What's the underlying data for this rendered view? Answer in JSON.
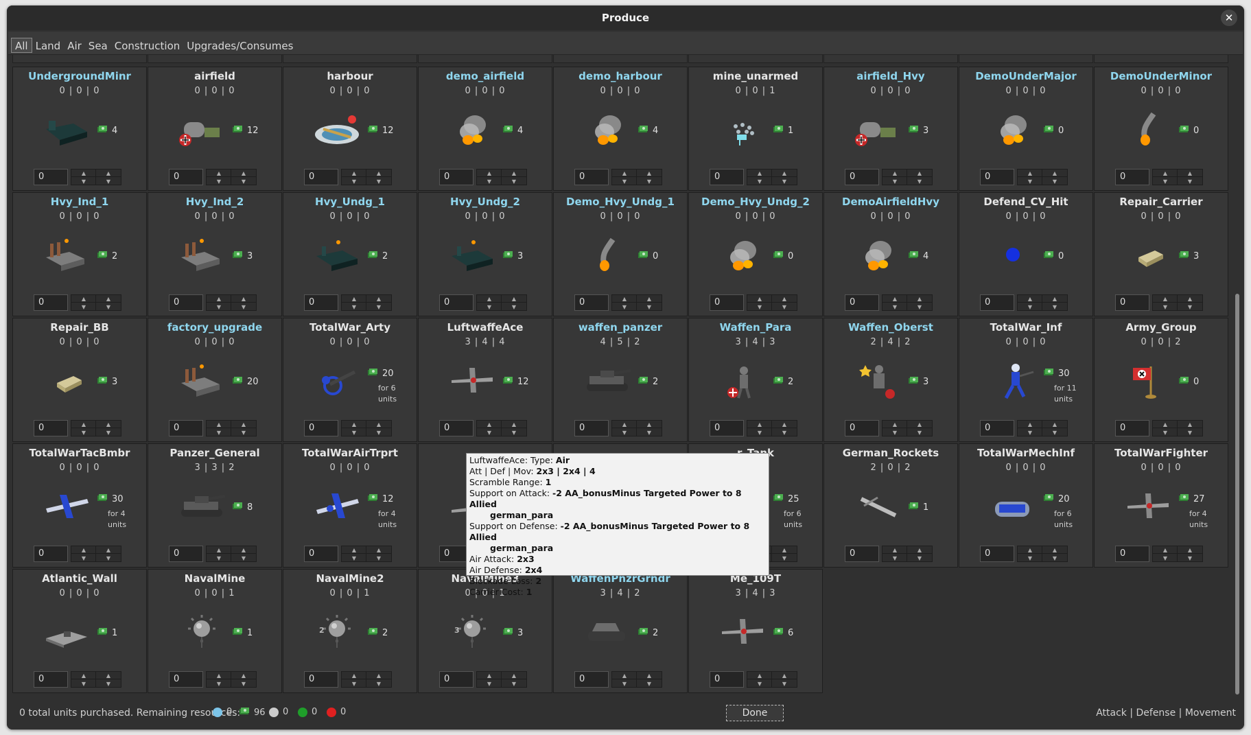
{
  "window": {
    "title": "Produce",
    "close": "✕"
  },
  "tabs": [
    "All",
    "Land",
    "Air",
    "Sea",
    "Construction",
    "Upgrades/Consumes"
  ],
  "units": [
    {
      "name": "UndergroundMinr",
      "blue": true,
      "stats": "0 | 0 | 0",
      "cost": "4",
      "icon": "underground-mine-icon",
      "qty": "0"
    },
    {
      "name": "airfield",
      "blue": false,
      "stats": "0 | 0 | 0",
      "cost": "12",
      "icon": "airfield-icon",
      "qty": "0"
    },
    {
      "name": "harbour",
      "blue": false,
      "stats": "0 | 0 | 0",
      "cost": "12",
      "icon": "harbour-icon",
      "qty": "0"
    },
    {
      "name": "demo_airfield",
      "blue": true,
      "stats": "0 | 0 | 0",
      "cost": "4",
      "icon": "fire-icon",
      "qty": "0"
    },
    {
      "name": "demo_harbour",
      "blue": true,
      "stats": "0 | 0 | 0",
      "cost": "4",
      "icon": "fire-icon",
      "qty": "0"
    },
    {
      "name": "mine_unarmed",
      "blue": false,
      "stats": "0 | 0 | 1",
      "cost": "1",
      "icon": "minefield-icon",
      "qty": "0"
    },
    {
      "name": "airfield_Hvy",
      "blue": true,
      "stats": "0 | 0 | 0",
      "cost": "3",
      "icon": "airfield-icon",
      "qty": "0"
    },
    {
      "name": "DemoUnderMajor",
      "blue": true,
      "stats": "0 | 0 | 0",
      "cost": "0",
      "icon": "fire-icon",
      "qty": "0"
    },
    {
      "name": "DemoUnderMinor",
      "blue": true,
      "stats": "0 | 0 | 0",
      "cost": "0",
      "icon": "flame-icon",
      "qty": "0"
    },
    {
      "name": "Hvy_Ind_1",
      "blue": true,
      "stats": "0 | 0 | 0",
      "cost": "2",
      "icon": "factory-icon",
      "qty": "0"
    },
    {
      "name": "Hvy_Ind_2",
      "blue": true,
      "stats": "0 | 0 | 0",
      "cost": "3",
      "icon": "factory-icon",
      "qty": "0"
    },
    {
      "name": "Hvy_Undg_1",
      "blue": true,
      "stats": "0 | 0 | 0",
      "cost": "2",
      "icon": "underground-factory-icon",
      "qty": "0"
    },
    {
      "name": "Hvy_Undg_2",
      "blue": true,
      "stats": "0 | 0 | 0",
      "cost": "3",
      "icon": "underground-factory-icon",
      "qty": "0"
    },
    {
      "name": "Demo_Hvy_Undg_1",
      "blue": true,
      "stats": "0 | 0 | 0",
      "cost": "0",
      "icon": "flame-icon",
      "qty": "0"
    },
    {
      "name": "Demo_Hvy_Undg_2",
      "blue": true,
      "stats": "0 | 0 | 0",
      "cost": "0",
      "icon": "fire-icon",
      "qty": "0"
    },
    {
      "name": "DemoAirfieldHvy",
      "blue": true,
      "stats": "0 | 0 | 0",
      "cost": "4",
      "icon": "fire-icon",
      "qty": "0"
    },
    {
      "name": "Defend_CV_Hit",
      "blue": false,
      "stats": "0 | 0 | 0",
      "cost": "0",
      "icon": "blue-dot-icon",
      "qty": "0"
    },
    {
      "name": "Repair_Carrier",
      "blue": false,
      "stats": "0 | 0 | 0",
      "cost": "3",
      "icon": "money-stack-icon",
      "qty": "0"
    },
    {
      "name": "Repair_BB",
      "blue": false,
      "stats": "0 | 0 | 0",
      "cost": "3",
      "icon": "money-stack-icon",
      "qty": "0"
    },
    {
      "name": "factory_upgrade",
      "blue": true,
      "stats": "0 | 0 | 0",
      "cost": "20",
      "icon": "factory-icon",
      "qty": "0"
    },
    {
      "name": "TotalWar_Arty",
      "blue": false,
      "stats": "0 | 0 | 0",
      "cost": "20",
      "for_units": "for 6 units",
      "icon": "artillery-icon",
      "qty": "0"
    },
    {
      "name": "LuftwaffeAce",
      "blue": false,
      "stats": "3 | 4 | 4",
      "cost": "12",
      "icon": "fighter-plane-icon",
      "qty": "0"
    },
    {
      "name": "waffen_panzer",
      "blue": true,
      "stats": "4 | 5 | 2",
      "cost": "2",
      "icon": "tank-icon",
      "qty": "0"
    },
    {
      "name": "Waffen_Para",
      "blue": true,
      "stats": "3 | 4 | 3",
      "cost": "2",
      "icon": "paratrooper-icon",
      "qty": "0"
    },
    {
      "name": "Waffen_Oberst",
      "blue": true,
      "stats": "2 | 4 | 2",
      "cost": "3",
      "icon": "officer-icon",
      "qty": "0"
    },
    {
      "name": "TotalWar_Inf",
      "blue": false,
      "stats": "0 | 0 | 0",
      "cost": "30",
      "for_units": "for 11 units",
      "icon": "infantry-icon",
      "qty": "0"
    },
    {
      "name": "Army_Group",
      "blue": false,
      "stats": "0 | 0 | 2",
      "cost": "0",
      "icon": "flag-icon",
      "qty": "0"
    },
    {
      "name": "TotalWarTacBmbr",
      "blue": false,
      "stats": "0 | 0 | 0",
      "cost": "30",
      "for_units": "for 4 units",
      "icon": "bomber-plane-icon",
      "qty": "0"
    },
    {
      "name": "Panzer_General",
      "blue": false,
      "stats": "3 | 3 | 2",
      "cost": "8",
      "icon": "tank-icon",
      "qty": "0"
    },
    {
      "name": "TotalWarAirTrprt",
      "blue": false,
      "stats": "0 | 0 | 0",
      "cost": "12",
      "for_units": "for 4 units",
      "icon": "transport-plane-icon",
      "qty": "0"
    },
    {
      "name": "",
      "blue": false,
      "stats": "",
      "cost": "",
      "icon": "plane-icon",
      "qty": "0"
    },
    {
      "name": "",
      "blue": false,
      "stats": "",
      "cost": "",
      "icon": "",
      "qty": "0"
    },
    {
      "name": "r_Tank",
      "blue": false,
      "stats": "0",
      "cost": "25",
      "for_units": "for 6 units",
      "icon": "",
      "qty": "0"
    },
    {
      "name": "German_Rockets",
      "blue": false,
      "stats": "2 | 0 | 2",
      "cost": "1",
      "icon": "rocket-icon",
      "qty": "0"
    },
    {
      "name": "TotalWarMechInf",
      "blue": false,
      "stats": "0 | 0 | 0",
      "cost": "20",
      "for_units": "for 6 units",
      "icon": "mech-infantry-icon",
      "qty": "0"
    },
    {
      "name": "TotalWarFighter",
      "blue": false,
      "stats": "0 | 0 | 0",
      "cost": "27",
      "for_units": "for 4 units",
      "icon": "fighter-plane-icon",
      "qty": "0"
    },
    {
      "name": "Atlantic_Wall",
      "blue": false,
      "stats": "0 | 0 | 0",
      "cost": "1",
      "icon": "bunker-icon",
      "qty": "0"
    },
    {
      "name": "NavalMine",
      "blue": false,
      "stats": "0 | 0 | 1",
      "cost": "1",
      "icon": "naval-mine-icon",
      "qty": "0"
    },
    {
      "name": "NavalMine2",
      "blue": false,
      "stats": "0 | 0 | 1",
      "cost": "2",
      "icon": "naval-mine-icon",
      "mine_digit": "2",
      "qty": "0"
    },
    {
      "name": "NavalMine3",
      "blue": false,
      "stats": "0 | 0 | 1",
      "cost": "3",
      "icon": "naval-mine-icon",
      "mine_digit": "3",
      "qty": "0"
    },
    {
      "name": "WaffenPnzrGrndr",
      "blue": true,
      "stats": "3 | 4 | 2",
      "cost": "2",
      "icon": "halftrack-icon",
      "qty": "0"
    },
    {
      "name": "Me_109T",
      "blue": false,
      "stats": "3 | 4 | 3",
      "cost": "6",
      "icon": "fighter-plane-icon",
      "qty": "0"
    }
  ],
  "tooltip": {
    "lines": [
      {
        "pre": "LuftwaffeAce: Type: ",
        "bold": "Air"
      },
      {
        "pre": "Att | Def | Mov: ",
        "bold": "2x3 | 2x4 | 4"
      },
      {
        "pre": "Scramble Range: ",
        "bold": "1"
      },
      {
        "pre": "Support on Attack: ",
        "bold": "-2 AA_bonusMinus Targeted Power to 8 Allied"
      },
      {
        "indent": "german_para"
      },
      {
        "pre": "Support on Defense: ",
        "bold": "-2 AA_bonusMinus Targeted Power to 8 Allied"
      },
      {
        "indent": "german_para"
      },
      {
        "pre": "Air Attack: ",
        "bold": "2x3"
      },
      {
        "pre": "Air Defense: ",
        "bold": "2x4"
      },
      {
        "pre": "Blockade Loss: ",
        "bold": "2"
      },
      {
        "pre": "Carrier Cost: ",
        "bold": "1"
      }
    ]
  },
  "footer": {
    "summary": "0 total units purchased. Remaining resources:",
    "resources": [
      {
        "icon": "flask-icon",
        "value": "0",
        "color": "#7cc4e8"
      },
      {
        "icon": "money-icon",
        "value": "96",
        "color": "#4caf50"
      },
      {
        "icon": "skull-icon",
        "value": "0",
        "color": "#cccccc"
      },
      {
        "icon": "green-globe-icon",
        "value": "0",
        "color": "#1f9e2a"
      },
      {
        "icon": "red-globe-icon",
        "value": "0",
        "color": "#e02020"
      }
    ],
    "done": "Done",
    "legend": "Attack | Defense | Movement"
  },
  "colors": {
    "blue_name": "#8fd6ee",
    "background": "#303030"
  }
}
